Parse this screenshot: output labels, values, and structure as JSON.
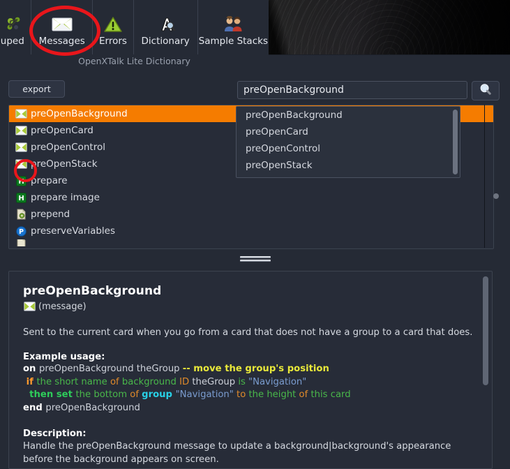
{
  "toolbar": {
    "items": [
      {
        "id": "grouped",
        "label": "rouped",
        "icon": "grouped-icon"
      },
      {
        "id": "messages",
        "label": "Messages",
        "icon": "envelope-icon"
      },
      {
        "id": "errors",
        "label": "Errors",
        "icon": "warning-triangle-icon"
      },
      {
        "id": "dictionary",
        "label": "Dictionary",
        "icon": "dictionary-magnifier-icon"
      },
      {
        "id": "samples",
        "label": "Sample Stacks",
        "icon": "two-people-icon"
      }
    ]
  },
  "app_caption": "OpenXTalk Lite Dictionary",
  "export_label": "export",
  "search": {
    "value": "preOpenBackground",
    "placeholder": "",
    "button_icon": "magnifier-icon"
  },
  "dropdown": {
    "items": [
      "preOpenBackground",
      "preOpenCard",
      "preOpenControl",
      "preOpenStack"
    ]
  },
  "list": {
    "rows": [
      {
        "label": "preOpenBackground",
        "icon": "envelope-icon",
        "selected": true
      },
      {
        "label": "preOpenCard",
        "icon": "envelope-icon",
        "selected": false
      },
      {
        "label": "preOpenControl",
        "icon": "envelope-icon",
        "selected": false
      },
      {
        "label": "preOpenStack",
        "icon": "envelope-icon",
        "selected": false
      },
      {
        "label": "prepare",
        "icon": "handler-h-icon",
        "selected": false
      },
      {
        "label": "prepare image",
        "icon": "handler-h-icon",
        "selected": false
      },
      {
        "label": "prepend",
        "icon": "file-gear-icon",
        "selected": false
      },
      {
        "label": "preserveVariables",
        "icon": "property-p-icon",
        "selected": false
      }
    ]
  },
  "detail": {
    "title": "preOpenBackground",
    "type_icon": "envelope-icon",
    "type_label": "(message)",
    "summary": "Sent to the current card when you go from a card that does not have a group to a card that does.",
    "example_head": "Example usage:",
    "code_lines": [
      [
        {
          "t": "on ",
          "c": "kw-on"
        },
        {
          "t": "preOpenBackground theGroup ",
          "c": "plain"
        },
        {
          "t": "-- move the group's position",
          "c": "cmt"
        }
      ],
      [
        {
          "t": " if ",
          "c": "kw-if"
        },
        {
          "t": "the short name ",
          "c": "green"
        },
        {
          "t": "of ",
          "c": "orange"
        },
        {
          "t": "background ",
          "c": "green"
        },
        {
          "t": "ID ",
          "c": "orange"
        },
        {
          "t": "theGroup ",
          "c": "plain"
        },
        {
          "t": "is ",
          "c": "green"
        },
        {
          "t": "\"Navigation\"",
          "c": "str"
        }
      ],
      [
        {
          "t": "  then ",
          "c": "kw-then"
        },
        {
          "t": "set ",
          "c": "kw-set"
        },
        {
          "t": "the bottom ",
          "c": "green"
        },
        {
          "t": "of ",
          "c": "orange"
        },
        {
          "t": "group ",
          "c": "kw-group"
        },
        {
          "t": "\"Navigation\" ",
          "c": "str"
        },
        {
          "t": "to ",
          "c": "orange"
        },
        {
          "t": "the height ",
          "c": "green"
        },
        {
          "t": "of ",
          "c": "orange"
        },
        {
          "t": "this card",
          "c": "green"
        }
      ],
      [
        {
          "t": "end ",
          "c": "kw-on"
        },
        {
          "t": "preOpenBackground",
          "c": "plain"
        }
      ]
    ],
    "description_head": "Description:",
    "description_body": "Handle the preOpenBackground message to update a background|background's appearance before the background appears on screen."
  },
  "colors": {
    "accent_selected": "#f57c00",
    "annotation": "#e8161b",
    "panel_bg": "#272c38",
    "window_bg": "#252a35"
  }
}
